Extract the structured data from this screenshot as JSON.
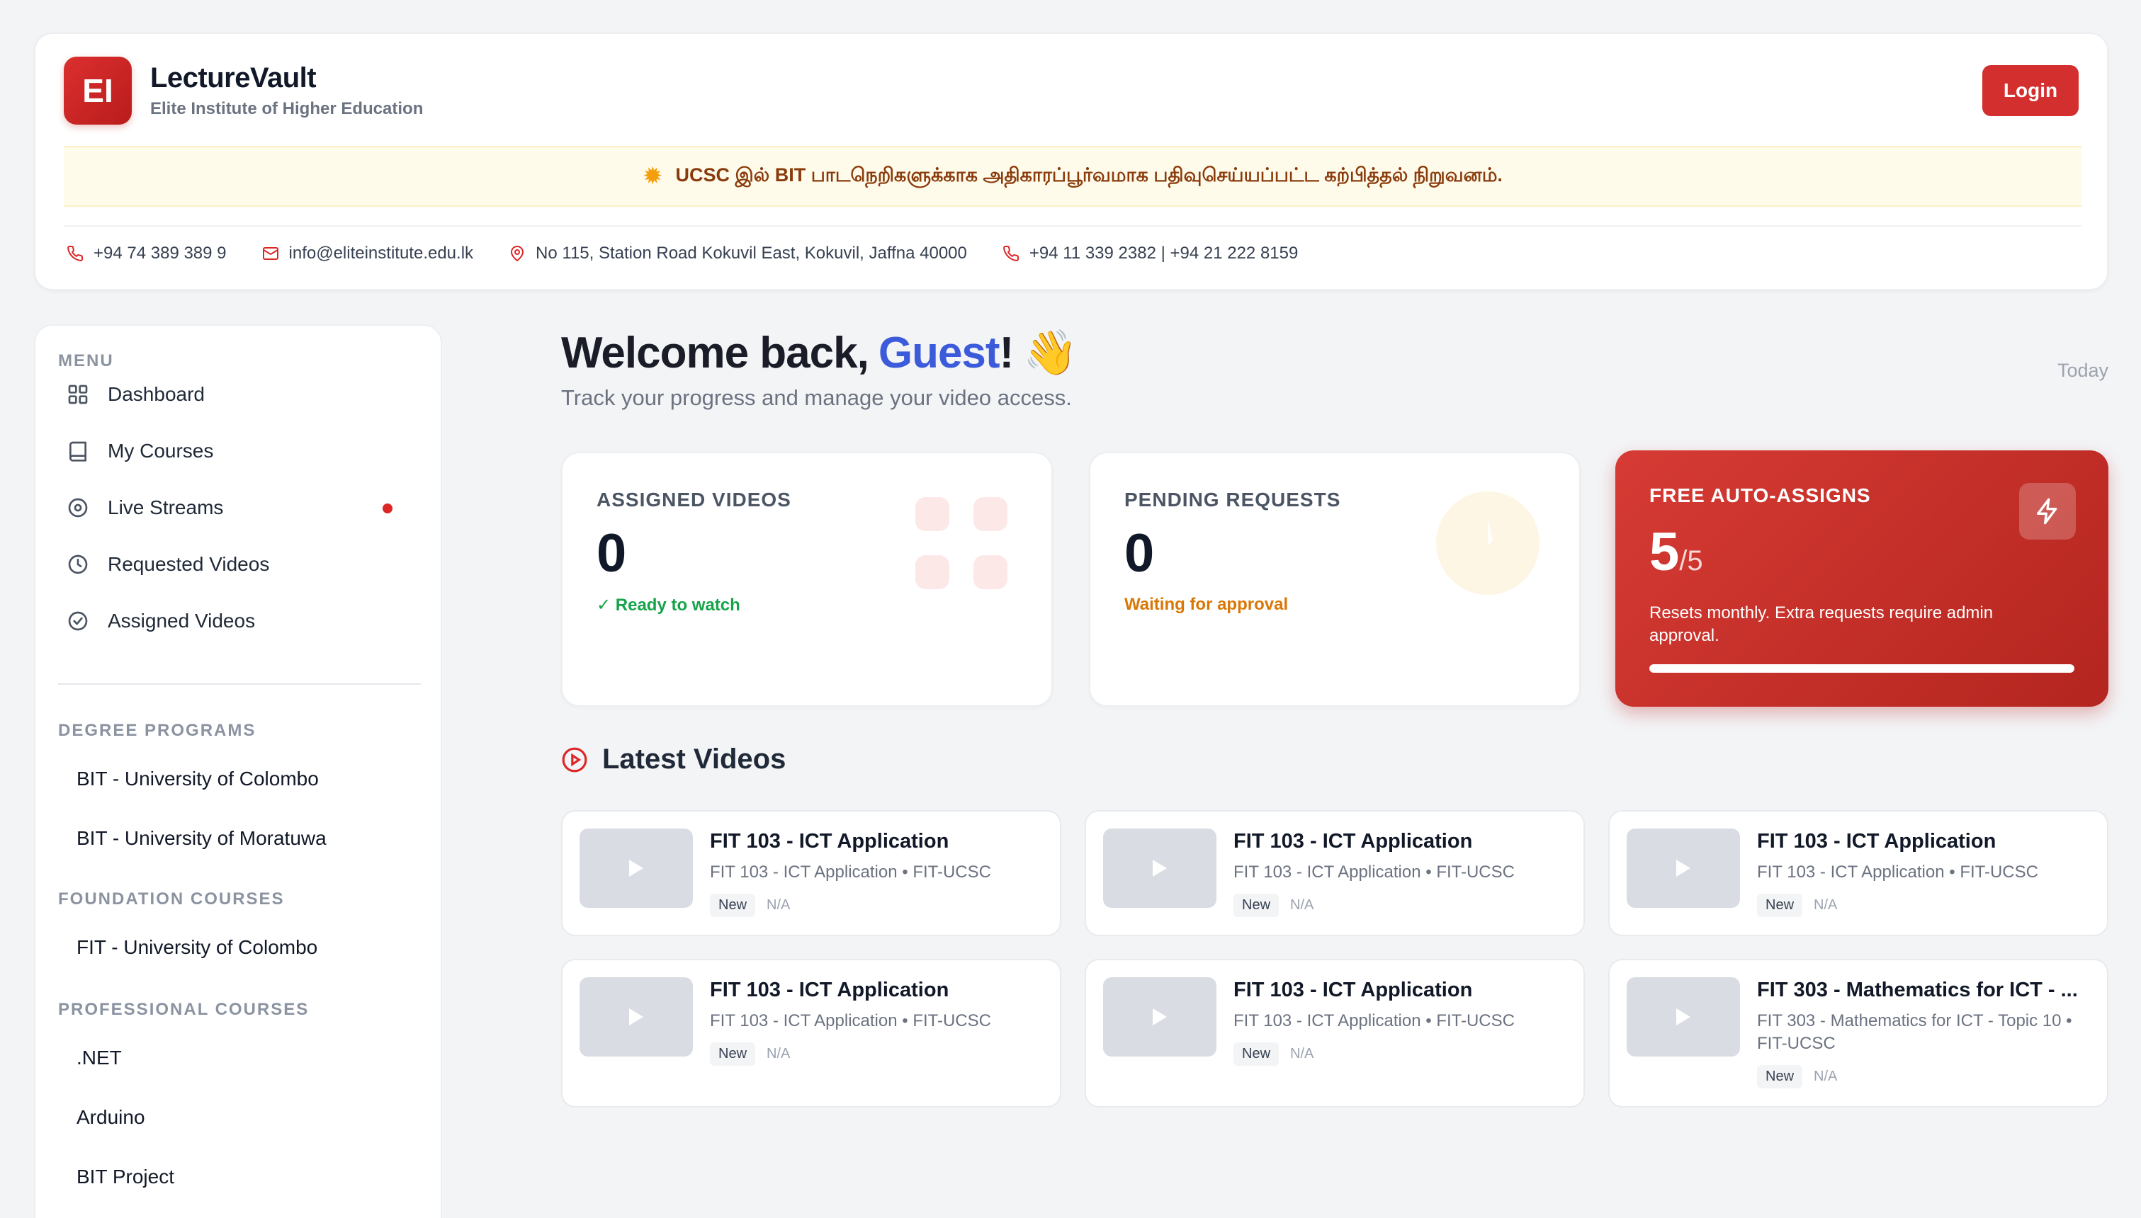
{
  "header": {
    "logo_text": "EI",
    "brand_name": "LectureVault",
    "brand_sub": "Elite Institute of Higher Education",
    "login_label": "Login",
    "notice_icon": "sun-icon",
    "notice_text": "UCSC இல் BIT பாடநெறிகளுக்காக அதிகாரப்பூர்வமாக பதிவுசெய்யப்பட்ட கற்பித்தல் நிறுவனம்.",
    "contacts": {
      "phone": "+94 74 389 389 9",
      "email": "info@eliteinstitute.edu.lk",
      "address": "No 115, Station Road Kokuvil East, Kokuvil, Jaffna 40000",
      "landlines": "+94 11 339 2382 | +94 21 222 8159"
    }
  },
  "sidebar": {
    "menu_title": "MENU",
    "menu": [
      {
        "label": "Dashboard",
        "icon": "grid-icon"
      },
      {
        "label": "My Courses",
        "icon": "book-icon"
      },
      {
        "label": "Live Streams",
        "icon": "target-icon"
      },
      {
        "label": "Requested Videos",
        "icon": "clock-icon"
      },
      {
        "label": "Assigned Videos",
        "icon": "check-circle-icon"
      }
    ],
    "degree_title": "DEGREE PROGRAMS",
    "degree": [
      "BIT - University of Colombo",
      "BIT - University of Moratuwa"
    ],
    "foundation_title": "FOUNDATION COURSES",
    "foundation": [
      "FIT - University of Colombo"
    ],
    "professional_title": "PROFESSIONAL COURSES",
    "professional": [
      ".NET",
      "Arduino",
      "BIT Project"
    ]
  },
  "main": {
    "welcome_prefix": "Welcome back,",
    "welcome_name": "Guest",
    "welcome_suffix": "!",
    "welcome_emoji": "👋",
    "subtitle": "Track your progress and manage your video access.",
    "today": "Today",
    "stats": {
      "assigned": {
        "label": "ASSIGNED VIDEOS",
        "value": "0",
        "note": "✓  Ready to watch"
      },
      "pending": {
        "label": "PENDING REQUESTS",
        "value": "0",
        "note": "Waiting for approval"
      },
      "auto": {
        "label": "FREE AUTO-ASSIGNS",
        "value": "5",
        "max": "/5",
        "note": "Resets monthly. Extra requests require admin approval.",
        "progress": 1.0
      }
    },
    "latest_title": "Latest Videos",
    "videos": [
      {
        "title": "FIT 103 - ICT Application",
        "sub": "FIT 103 - ICT Application • FIT-UCSC",
        "badge": "New",
        "meta": "N/A"
      },
      {
        "title": "FIT 103 - ICT Application",
        "sub": "FIT 103 - ICT Application • FIT-UCSC",
        "badge": "New",
        "meta": "N/A"
      },
      {
        "title": "FIT 103 - ICT Application",
        "sub": "FIT 103 - ICT Application • FIT-UCSC",
        "badge": "New",
        "meta": "N/A"
      },
      {
        "title": "FIT 103 - ICT Application",
        "sub": "FIT 103 - ICT Application • FIT-UCSC",
        "badge": "New",
        "meta": "N/A"
      },
      {
        "title": "FIT 103 - ICT Application",
        "sub": "FIT 103 - ICT Application • FIT-UCSC",
        "badge": "New",
        "meta": "N/A"
      },
      {
        "title": "FIT 303 - Mathematics for ICT - ...",
        "sub": "FIT 303 - Mathematics for ICT - Topic 10 • FIT-UCSC",
        "badge": "New",
        "meta": "N/A"
      }
    ]
  },
  "colors": {
    "brand_red": "#d42f2f",
    "accent_blue": "#3b5bdb",
    "success_green": "#16a34a",
    "warning_amber": "#d97706"
  }
}
